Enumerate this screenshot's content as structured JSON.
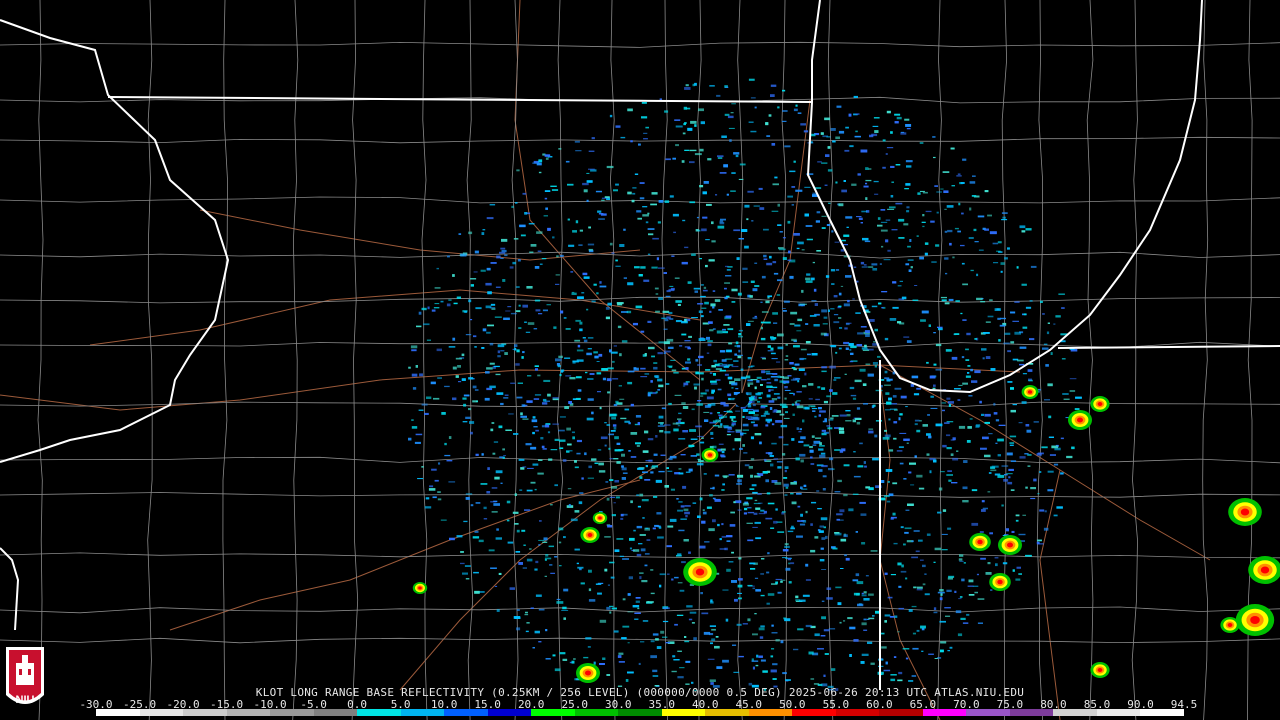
{
  "product_caption": "KLOT LONG RANGE BASE REFLECTIVITY (0.25KM / 256 LEVEL) (000000/0000 0.5 DEG) 2025-06-26 20:13 UTC  ATLAS.NIU.EDU",
  "logo": {
    "text": "NIU",
    "color": "#c8102e"
  },
  "colorbar": {
    "tick_labels": [
      "-30.0",
      "-25.0",
      "-20.0",
      "-15.0",
      "-10.0",
      "-5.0",
      "0.0",
      "5.0",
      "10.0",
      "15.0",
      "20.0",
      "25.0",
      "30.0",
      "35.0",
      "40.0",
      "45.0",
      "50.0",
      "55.0",
      "60.0",
      "65.0",
      "70.0",
      "75.0",
      "80.0",
      "85.0",
      "90.0",
      "94.5"
    ],
    "colors": [
      "#ffffff",
      "#e6e6e6",
      "#cccccc",
      "#b3b3b3",
      "#999999",
      "#808080",
      "#00e5e5",
      "#00b4f0",
      "#0060ff",
      "#0000d0",
      "#00ff00",
      "#00c000",
      "#008c00",
      "#ffff00",
      "#e6be00",
      "#ff9000",
      "#ff0000",
      "#d40000",
      "#b40000",
      "#ff00ff",
      "#9955c8",
      "#7d3c9b",
      "#d2d2d2",
      "#ebebeb",
      "#ffffff"
    ]
  },
  "map_colors": {
    "state_border": "#ffffff",
    "county_border": "#8a8a8a",
    "highway": "#9c5a3a",
    "echo_colors": [
      "#1e90ff",
      "#00bfff",
      "#00d8e8",
      "#40e0d0",
      "#2f6fff"
    ],
    "storm_colors": [
      "#00c000",
      "#ffff00",
      "#ff9000",
      "#ff0000"
    ]
  },
  "radar_site": "KLOT"
}
